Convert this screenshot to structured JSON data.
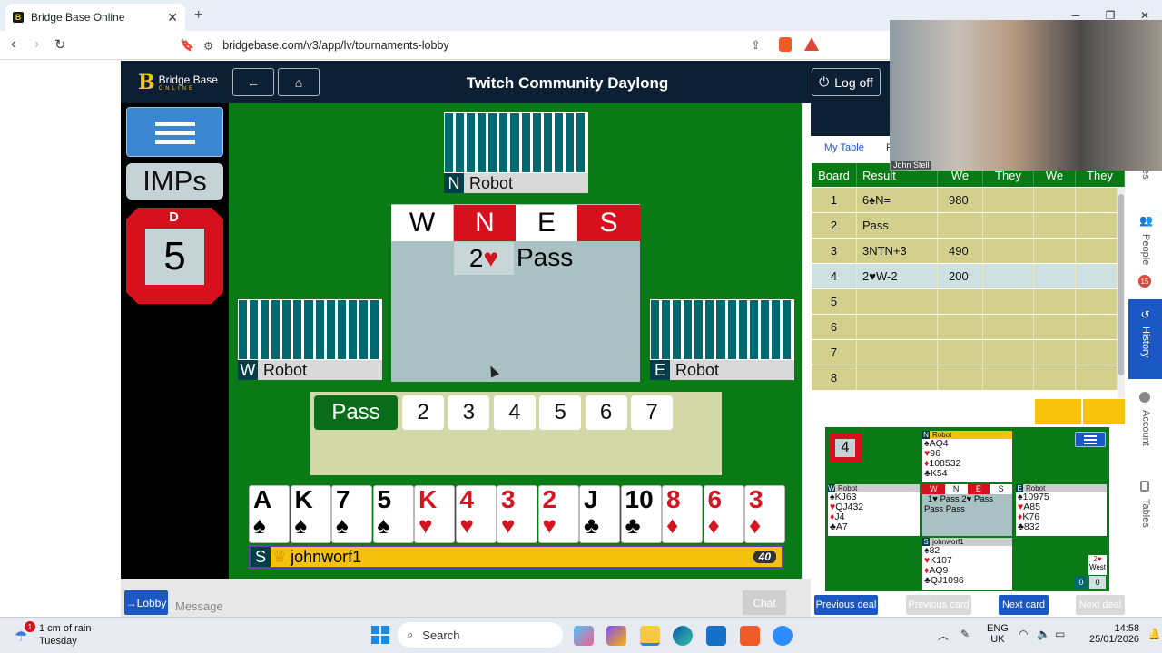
{
  "browser": {
    "tab_title": "Bridge Base Online",
    "url": "bridgebase.com/v3/app/lv/tournaments-lobby",
    "new_tab": "+",
    "close": "✕"
  },
  "app": {
    "logo_text": "Bridge Base",
    "logo_sub": "ONLINE",
    "title": "Twitch Community Daylong",
    "log_off": "Log off"
  },
  "scoring": "IMPs",
  "dealer": {
    "label": "D",
    "board": "5"
  },
  "seats": {
    "north": {
      "seat": "N",
      "name": "Robot"
    },
    "west": {
      "seat": "W",
      "name": "Robot"
    },
    "east": {
      "seat": "E",
      "name": "Robot"
    },
    "south": {
      "seat": "S",
      "name": "johnworf1",
      "score": "40"
    }
  },
  "auction": {
    "headers": [
      "W",
      "N",
      "E",
      "S"
    ],
    "bid_level": "2",
    "bid_suit": "♥",
    "pass": "Pass"
  },
  "bidding_box": {
    "pass": "Pass",
    "levels": [
      "2",
      "3",
      "4",
      "5",
      "6",
      "7"
    ]
  },
  "hand": [
    {
      "r": "A",
      "s": "♠",
      "c": "#000"
    },
    {
      "r": "K",
      "s": "♠",
      "c": "#000"
    },
    {
      "r": "7",
      "s": "♠",
      "c": "#000"
    },
    {
      "r": "5",
      "s": "♠",
      "c": "#000"
    },
    {
      "r": "K",
      "s": "♥",
      "c": "#d31620"
    },
    {
      "r": "4",
      "s": "♥",
      "c": "#d31620"
    },
    {
      "r": "3",
      "s": "♥",
      "c": "#d31620"
    },
    {
      "r": "2",
      "s": "♥",
      "c": "#d31620"
    },
    {
      "r": "J",
      "s": "♣",
      "c": "#000"
    },
    {
      "r": "10",
      "s": "♣",
      "c": "#000"
    },
    {
      "r": "8",
      "s": "♦",
      "c": "#d31620"
    },
    {
      "r": "6",
      "s": "♦",
      "c": "#d31620"
    },
    {
      "r": "3",
      "s": "♦",
      "c": "#d31620"
    }
  ],
  "chat": {
    "lobby": "→Lobby",
    "placeholder": "Message",
    "chat": "Chat"
  },
  "history": {
    "tabs": [
      "My Table",
      "R"
    ],
    "headers": [
      "Board",
      "Result",
      "We",
      "They",
      "We",
      "They"
    ],
    "rows": [
      [
        "1",
        "6♠N=",
        "980",
        ""
      ],
      [
        "2",
        "Pass",
        "",
        ""
      ],
      [
        "3",
        "3NTN+3",
        "490",
        ""
      ],
      [
        "4",
        "2♥W-2",
        "200",
        ""
      ],
      [
        "5",
        "",
        "",
        ""
      ],
      [
        "6",
        "",
        "",
        ""
      ],
      [
        "7",
        "",
        "",
        ""
      ],
      [
        "8",
        "",
        "",
        ""
      ]
    ]
  },
  "mini": {
    "board": "4",
    "north": {
      "name": "Robot",
      "lines": [
        "♠AQ4",
        "♥96",
        "♦108532",
        "♣K54"
      ]
    },
    "west": {
      "name": "Robot",
      "lines": [
        "♠KJ63",
        "♥QJ432",
        "♦J4",
        "♣A7"
      ]
    },
    "east": {
      "name": "Robot",
      "lines": [
        "♠10975",
        "♥A85",
        "♦K76",
        "♣832"
      ]
    },
    "south": {
      "name": "johnworf1",
      "lines": [
        "♠82",
        "♥K107",
        "♦AQ9",
        "♣QJ1096"
      ]
    },
    "auction_hdr": [
      "W",
      "N",
      "E",
      "S"
    ],
    "auction": "1♥ Pass 2♥ Pass",
    "auction2": "Pass Pass",
    "contract": "2♥",
    "declarer": "West",
    "score1": "0",
    "score2": "0"
  },
  "nav": {
    "prev_deal": "Previous deal",
    "prev_card": "Previous card",
    "next_card": "Next card",
    "next_deal": "Next deal"
  },
  "side": {
    "people": "People",
    "people_badge": "15",
    "history": "History",
    "account": "Account",
    "tables": "Tables",
    "es": "es"
  },
  "webcam": {
    "name": "John Stell"
  },
  "taskbar": {
    "weather": "1 cm of rain",
    "weather2": "Tuesday",
    "search": "Search",
    "lang": "ENG",
    "lang2": "UK",
    "time": "14:58",
    "date": "25/01/2026",
    "badge": "1"
  }
}
